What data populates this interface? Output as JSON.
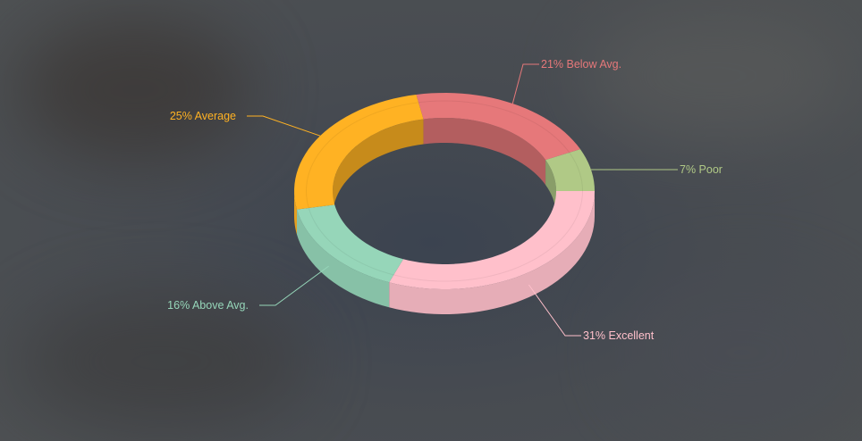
{
  "chart_data": {
    "type": "pie",
    "variant": "3d-donut",
    "slices": [
      {
        "name": "Excellent",
        "value": 31,
        "label": "31% Excellent",
        "color": "#ffc0cb"
      },
      {
        "name": "Above Avg.",
        "value": 16,
        "label": "16% Above Avg.",
        "color": "#96d6b9"
      },
      {
        "name": "Average",
        "value": 25,
        "label": "25% Average",
        "color": "#ffb223"
      },
      {
        "name": "Below Avg.",
        "value": 21,
        "label": "21% Below Avg.",
        "color": "#e6787a"
      },
      {
        "name": "Poor",
        "value": 7,
        "label": "7% Poor",
        "color": "#b0c986"
      }
    ]
  }
}
